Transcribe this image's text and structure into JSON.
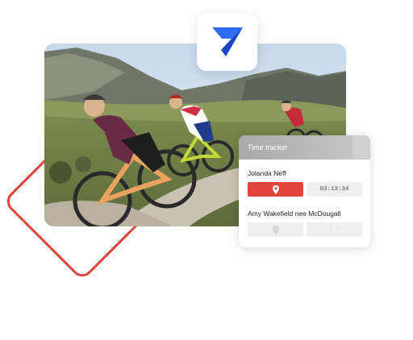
{
  "logo": {
    "icon": "app-logo-icon",
    "colors": [
      "#2f6cf6",
      "#1846c7"
    ]
  },
  "photo": {
    "description_icon": "mountain-bikers-photo"
  },
  "time_tracker": {
    "title": "Time tracker",
    "accent_color": "#e0443a",
    "athletes": [
      {
        "name": "Jolanda Neff",
        "location_state": "active",
        "time": "03:13:34",
        "location_icon": "location-pin-icon"
      },
      {
        "name": "Amy Wakefield nee McDougall",
        "location_state": "inactive",
        "time": ": :",
        "location_icon": "location-pin-icon"
      }
    ]
  }
}
